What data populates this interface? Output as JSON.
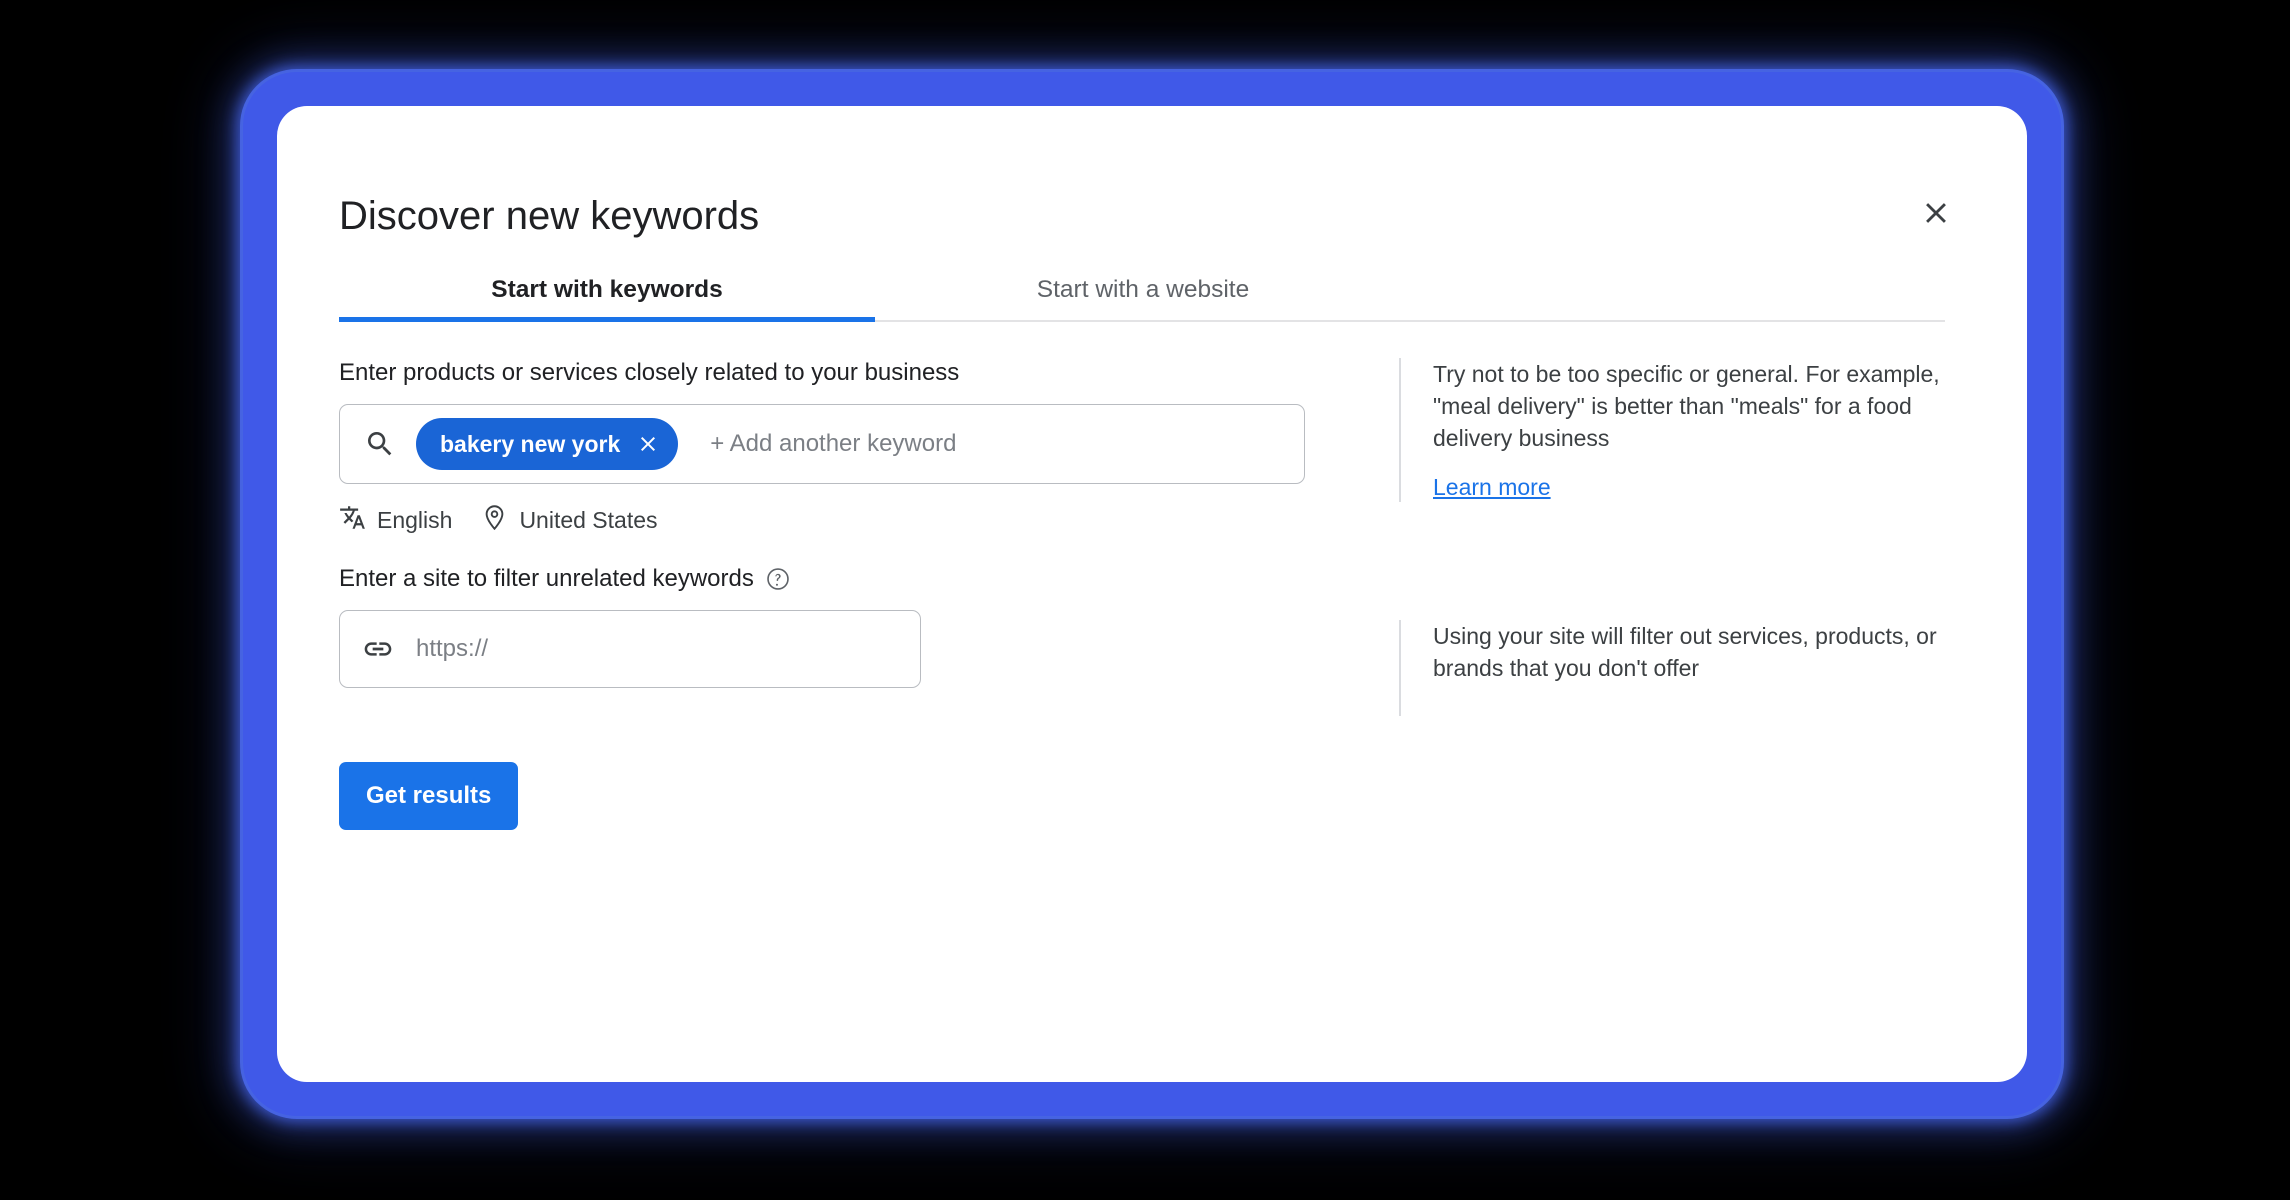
{
  "dialog": {
    "title": "Discover new keywords",
    "close_label": "Close",
    "close_icon": "close-icon"
  },
  "tabs": [
    {
      "label": "Start with keywords",
      "active": true
    },
    {
      "label": "Start with a website",
      "active": false
    }
  ],
  "keywords_section": {
    "label": "Enter products or services closely related to your business",
    "search_icon": "search-icon",
    "chips": [
      {
        "text": "bakery new york",
        "remove_icon": "close-icon"
      }
    ],
    "placeholder": "+ Add another keyword",
    "language": {
      "icon": "translate-icon",
      "value": "English"
    },
    "location": {
      "icon": "location-pin-icon",
      "value": "United States"
    },
    "help": {
      "text": "Try not to be too specific or general. For example, \"meal delivery\" is better than \"meals\" for a food delivery business",
      "link_label": "Learn more"
    }
  },
  "site_section": {
    "label": "Enter a site to filter unrelated keywords",
    "help_icon": "question-mark-icon",
    "link_icon": "link-icon",
    "placeholder": "https://",
    "value": "",
    "help": {
      "text": "Using your site will filter out services, products, or brands that you don't offer"
    }
  },
  "actions": {
    "submit_label": "Get results"
  },
  "colors": {
    "accent": "#1a73e8",
    "chip_background": "#1a65d6",
    "glow": "#4059e8",
    "text_primary": "#202124",
    "text_secondary": "#3c4043",
    "placeholder": "#7b7f85",
    "border": "#b9bcc1",
    "divider": "#dadce0"
  }
}
